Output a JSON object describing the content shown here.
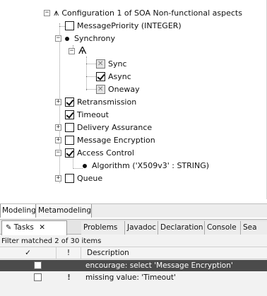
{
  "tree": {
    "root_label": "Configuration 1 of SOA Non-functional aspects",
    "items": [
      {
        "label": "MessagePriority (INTEGER)"
      },
      {
        "label": "Synchrony"
      },
      {
        "label": "Sync"
      },
      {
        "label": "Async"
      },
      {
        "label": "Oneway"
      },
      {
        "label": "Retransmission"
      },
      {
        "label": "Timeout"
      },
      {
        "label": "Delivery Assurance"
      },
      {
        "label": "Message Encryption"
      },
      {
        "label": "Access Control"
      },
      {
        "label": "Algorithm ('X509v3' : STRING)"
      },
      {
        "label": "Queue"
      }
    ]
  },
  "editor_tabs": {
    "modeling": "Modeling",
    "metamodeling": "Metamodeling"
  },
  "view_tabs": {
    "tasks": "Tasks",
    "close_glyph": "✕",
    "problems": "Problems",
    "javadoc": "Javadoc",
    "declaration": "Declaration",
    "console": "Console",
    "search_truncated": "Sea"
  },
  "tasks": {
    "filter_text": "Filter matched 2 of 30 items",
    "columns": {
      "done": "✓",
      "priority": "!",
      "description": "Description"
    },
    "rows": [
      {
        "priority": "",
        "description": "encourage: select 'Message Encryption'"
      },
      {
        "priority": "!",
        "description": "missing value: 'Timeout'"
      }
    ]
  }
}
